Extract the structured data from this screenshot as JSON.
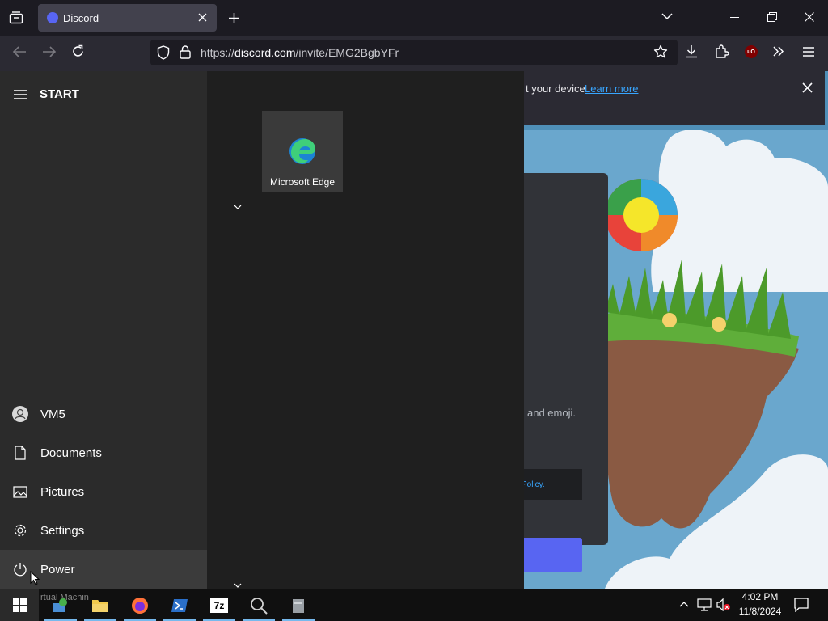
{
  "browser": {
    "tab_title": "Discord",
    "url_scheme": "https://",
    "url_host": "discord.com",
    "url_path": "/invite/EMG2BgbYFr"
  },
  "page": {
    "notification_text": "t your device.",
    "notification_link": "Learn more",
    "card_text_emoji": "and emoji.",
    "card_text_policy": "Policy."
  },
  "start_menu": {
    "header": "START",
    "tile_edge": "Microsoft Edge",
    "items": {
      "user": "VM5",
      "documents": "Documents",
      "pictures": "Pictures",
      "settings": "Settings",
      "power": "Power"
    }
  },
  "taskbar": {
    "time": "4:02 PM",
    "date": "11/8/2024",
    "hidden_label": "rtual Machin"
  },
  "colors": {
    "accent": "#5865f2",
    "link": "#38a6ff",
    "taskbar_highlight": "#76b9ed"
  }
}
